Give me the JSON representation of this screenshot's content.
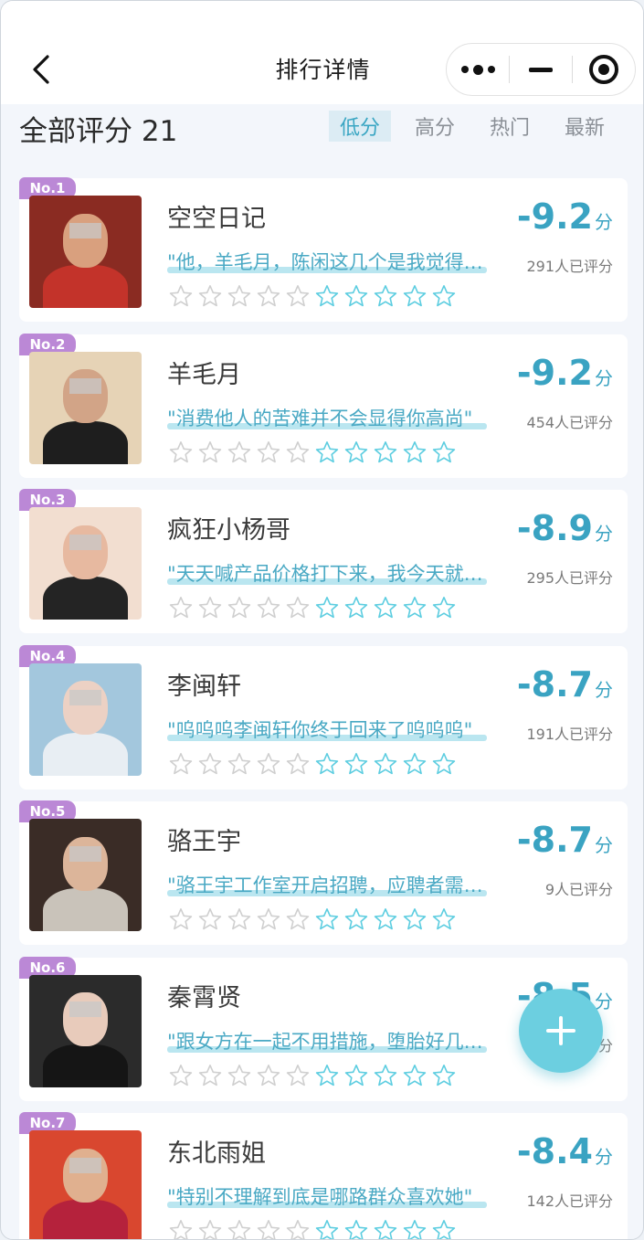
{
  "nav": {
    "title": "排行详情"
  },
  "header": {
    "total_label": "全部评分 21",
    "sort_tabs": [
      {
        "label": "低分",
        "active": true
      },
      {
        "label": "高分",
        "active": false
      },
      {
        "label": "热门",
        "active": false
      },
      {
        "label": "最新",
        "active": false
      }
    ]
  },
  "score_unit": "分",
  "colors": {
    "accent": "#3aa3c2",
    "badge": "#bb88d6",
    "fab": "#6ccfe0"
  },
  "items": [
    {
      "rank": "No.1",
      "name": "空空日记",
      "quote": "\"他，羊毛月，陈闲这几个是我觉得最恶心的网红\"",
      "score": "-9.2",
      "raters": "291人已评分",
      "avatar_bg": "#8a2b22",
      "avatar_skin": "#d9a07e",
      "avatar_cloth": "#c3332a"
    },
    {
      "rank": "No.2",
      "name": "羊毛月",
      "quote": "\"消费他人的苦难并不会显得你高尚\"",
      "score": "-9.2",
      "raters": "454人已评分",
      "avatar_bg": "#e6d3b6",
      "avatar_skin": "#d2a487",
      "avatar_cloth": "#1e1e1e"
    },
    {
      "rank": "No.3",
      "name": "疯狂小杨哥",
      "quote": "\"天天喊产品价格打下来，我今天就把你打下来\"",
      "score": "-8.9",
      "raters": "295人已评分",
      "avatar_bg": "#f2ded0",
      "avatar_skin": "#e7b9a0",
      "avatar_cloth": "#242424"
    },
    {
      "rank": "No.4",
      "name": "李闽轩",
      "quote": "\"呜呜呜李闽轩你终于回来了呜呜呜\"",
      "score": "-8.7",
      "raters": "191人已评分",
      "avatar_bg": "#a3c7dd",
      "avatar_skin": "#ecd1c4",
      "avatar_cloth": "#e8eef3"
    },
    {
      "rank": "No.5",
      "name": "骆王宇",
      "quote": "\"骆王宇工作室开启招聘，应聘者需要有过被网暴的经历\"",
      "score": "-8.7",
      "raters": "9人已评分",
      "avatar_bg": "#3a2c26",
      "avatar_skin": "#dcb59a",
      "avatar_cloth": "#c9c3ba"
    },
    {
      "rank": "No.6",
      "name": "秦霄贤",
      "quote": "\"跟女方在一起不用措施，堕胎好几次\"",
      "score": "-8.5",
      "raters": "103人已评分",
      "avatar_bg": "#2b2b2b",
      "avatar_skin": "#e8cbbb",
      "avatar_cloth": "#151515"
    },
    {
      "rank": "No.7",
      "name": "东北雨姐",
      "quote": "\"特别不理解到底是哪路群众喜欢她\"",
      "score": "-8.4",
      "raters": "142人已评分",
      "avatar_bg": "#d9472f",
      "avatar_skin": "#e0b08f",
      "avatar_cloth": "#b5223c"
    }
  ]
}
